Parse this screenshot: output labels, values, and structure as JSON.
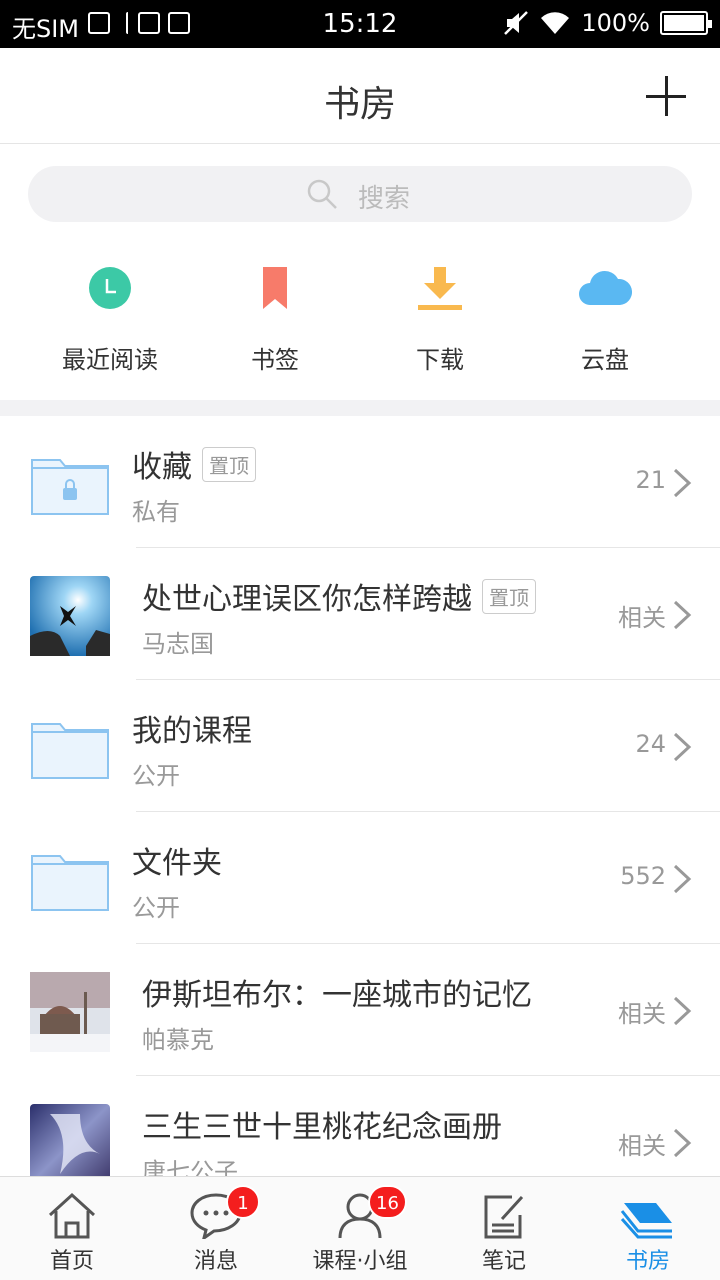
{
  "status_bar": {
    "sim": "无SIM",
    "time": "15:12",
    "battery": "100%"
  },
  "header": {
    "title": "书房"
  },
  "search": {
    "placeholder": "搜索"
  },
  "quick_actions": [
    {
      "label": "最近阅读",
      "icon": "clock-icon",
      "color": "#3cc9a6"
    },
    {
      "label": "书签",
      "icon": "bookmark-icon",
      "color": "#f77b6a"
    },
    {
      "label": "下载",
      "icon": "download-icon",
      "color": "#f9b94e"
    },
    {
      "label": "云盘",
      "icon": "cloud-icon",
      "color": "#5ab8f2"
    }
  ],
  "items": [
    {
      "title": "收藏",
      "tag": "置顶",
      "subtitle": "私有",
      "meta": "21",
      "kind": "folder-locked"
    },
    {
      "title": "处世心理误区你怎样跨越",
      "tag": "置顶",
      "subtitle": "马志国",
      "meta": "相关",
      "kind": "book"
    },
    {
      "title": "我的课程",
      "tag": "",
      "subtitle": "公开",
      "meta": "24",
      "kind": "folder"
    },
    {
      "title": "文件夹",
      "tag": "",
      "subtitle": "公开",
      "meta": "552",
      "kind": "folder"
    },
    {
      "title": "伊斯坦布尔：一座城市的记忆",
      "tag": "",
      "subtitle": "帕慕克",
      "meta": "相关",
      "kind": "book"
    },
    {
      "title": "三生三世十里桃花纪念画册",
      "tag": "",
      "subtitle": "唐七公子",
      "meta": "相关",
      "kind": "book"
    }
  ],
  "tabs": [
    {
      "label": "首页",
      "icon": "home-icon",
      "badge": ""
    },
    {
      "label": "消息",
      "icon": "message-icon",
      "badge": "1"
    },
    {
      "label": "课程·小组",
      "icon": "person-icon",
      "badge": "16"
    },
    {
      "label": "笔记",
      "icon": "note-icon",
      "badge": ""
    },
    {
      "label": "书房",
      "icon": "bookshelf-icon",
      "badge": ""
    }
  ],
  "colors": {
    "accent": "#1a8fe6",
    "badge": "#f41e1e",
    "folder": "#8cc4f0"
  }
}
